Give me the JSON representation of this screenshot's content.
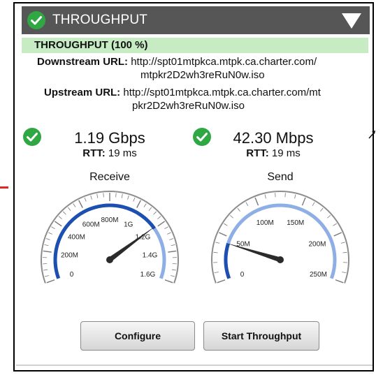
{
  "header": {
    "title": "THROUGHPUT"
  },
  "status": {
    "text": "THROUGHPUT (100 %)"
  },
  "urls": {
    "downstream_label": "Downstream URL:",
    "downstream_line1": "http://spt01mtpkca.mtpk.ca.charter.com/",
    "downstream_line2": "mtpkr2D2wh3reRuN0w.iso",
    "upstream_label": "Upstream URL:",
    "upstream_line1": "http://spt01mtpkca.mtpk.ca.charter.com/mt",
    "upstream_line2": "pkr2D2wh3reRuN0w.iso"
  },
  "receive": {
    "rate": "1.19 Gbps",
    "rtt_label": "RTT:",
    "rtt_value": "19 ms",
    "title": "Receive",
    "ticks": [
      "0",
      "200M",
      "400M",
      "600M",
      "800M",
      "1G",
      "1.2G",
      "1.4G",
      "1.6G"
    ],
    "max": 1.6,
    "value": 1.19,
    "fill_to": 1.2
  },
  "send": {
    "rate": "42.30 Mbps",
    "rtt_label": "RTT:",
    "rtt_value": "19 ms",
    "title": "Send",
    "ticks": [
      "0",
      "50M",
      "100M",
      "150M",
      "200M",
      "250M"
    ],
    "max": 250,
    "value": 42.3,
    "fill_to": 42.3
  },
  "buttons": {
    "configure": "Configure",
    "start": "Start Throughput"
  },
  "colors": {
    "header_bg": "#565656",
    "check": "#2fa844",
    "status_bg": "#c7ecc4",
    "gauge_dark": "#1d4fb0",
    "gauge_light": "#8eaee6"
  }
}
